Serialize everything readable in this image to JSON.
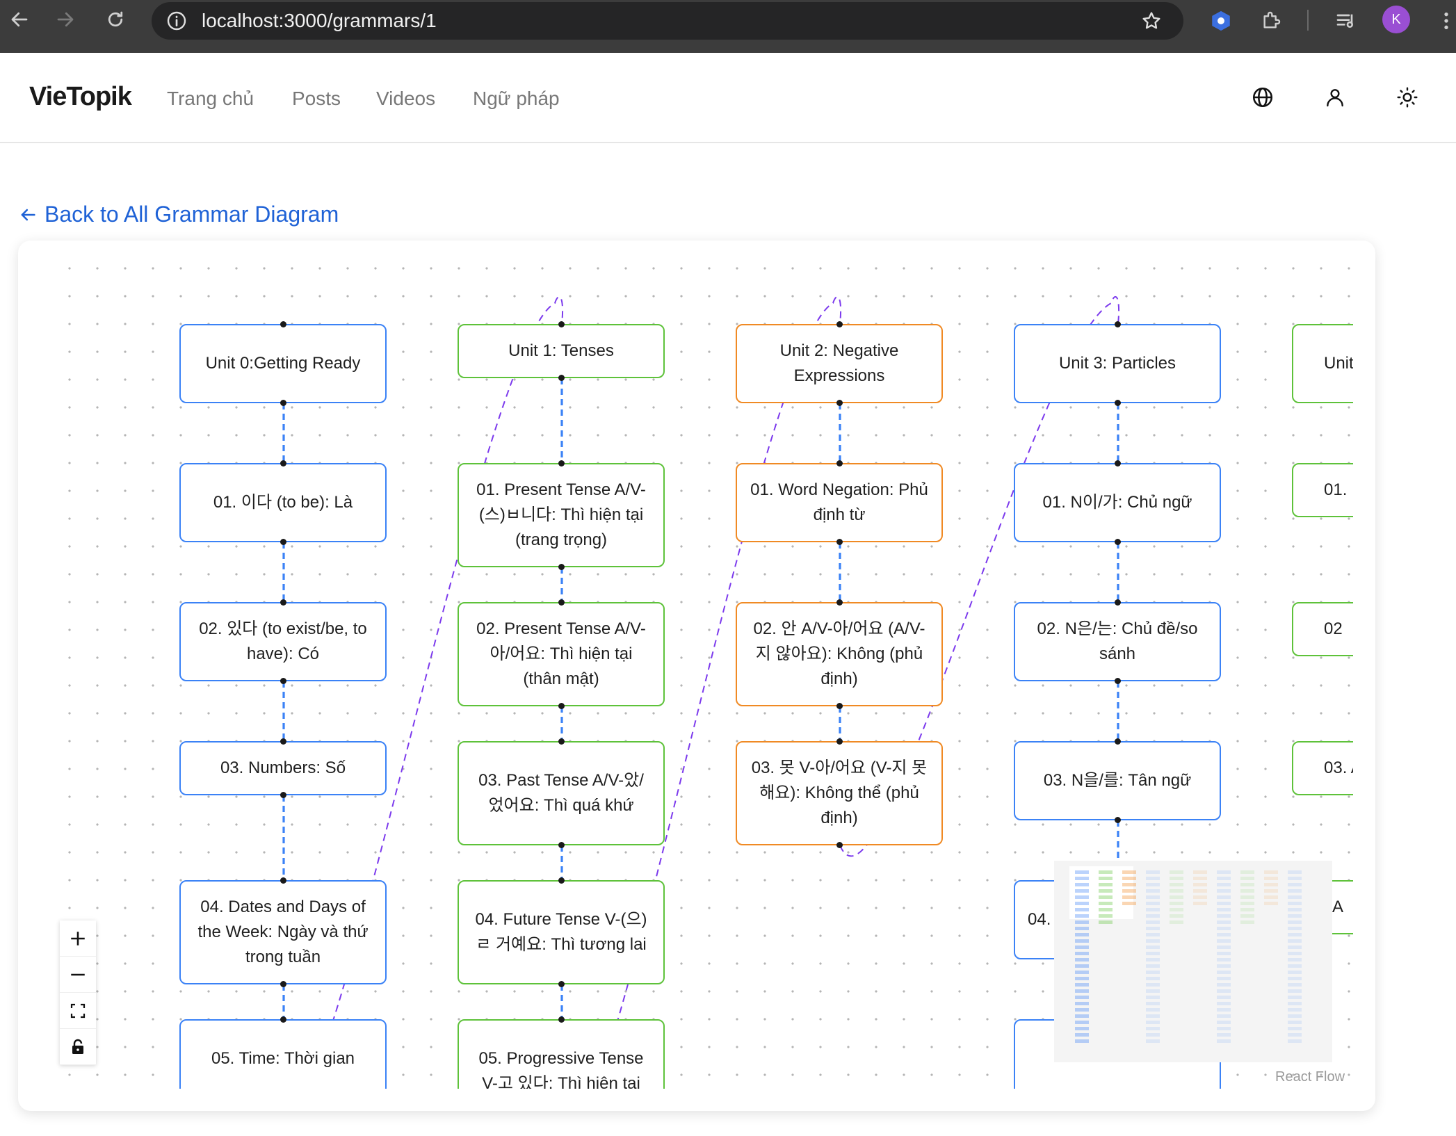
{
  "browser": {
    "url": "localhost:3000/grammars/1",
    "profile_initial": "K"
  },
  "header": {
    "brand": "VieTopik",
    "nav": [
      "Trang chủ",
      "Posts",
      "Videos",
      "Ngữ pháp"
    ]
  },
  "back_link": "Back to All Grammar Diagram",
  "colors": {
    "blue": "#3b82f6",
    "green": "#5ec23a",
    "orange": "#f08a24",
    "edge_purple": "#7c3aed",
    "link": "#1f62d6"
  },
  "columns": [
    {
      "color": "blue",
      "nodes": [
        "Unit 0:Getting Ready",
        "01. 이다 (to be): Là",
        "02. 있다 (to exist/be, to have): Có",
        "03. Numbers: Số",
        "04. Dates and Days of the Week: Ngày và thứ trong tuần",
        "05. Time: Thời gian"
      ]
    },
    {
      "color": "green",
      "nodes": [
        "Unit 1: Tenses",
        "01. Present Tense A/V-(스)ㅂ니다: Thì hiện tại (trang trọng)",
        "02. Present Tense A/V-아/어요: Thì hiện tại (thân mật)",
        "03. Past Tense A/V-았/었어요: Thì quá khứ",
        "04. Future Tense V-(으)ㄹ 거예요: Thì tương lai",
        "05. Progressive Tense V-고 있다: Thì hiện tại"
      ]
    },
    {
      "color": "orange",
      "nodes": [
        "Unit 2: Negative Expressions",
        "01. Word Negation: Phủ định từ",
        "02. 안 A/V-아/어요 (A/V-지 않아요): Không (phủ định)",
        "03. 못 V-아/어요 (V-지 못해요): Không thể (phủ định)"
      ]
    },
    {
      "color": "blue",
      "nodes": [
        "Unit 3: Particles",
        "01. N이/가: Chủ ngữ",
        "02. N은/는: Chủ đề/so sánh",
        "03. N을/를: Tân ngữ",
        "04.",
        ""
      ]
    },
    {
      "color": "green",
      "nodes": [
        "Unit",
        "01.",
        "02",
        "03. A",
        ". A"
      ]
    }
  ],
  "controls": [
    "zoom-in",
    "zoom-out",
    "fit-view",
    "lock"
  ],
  "attribution": "React Flow"
}
